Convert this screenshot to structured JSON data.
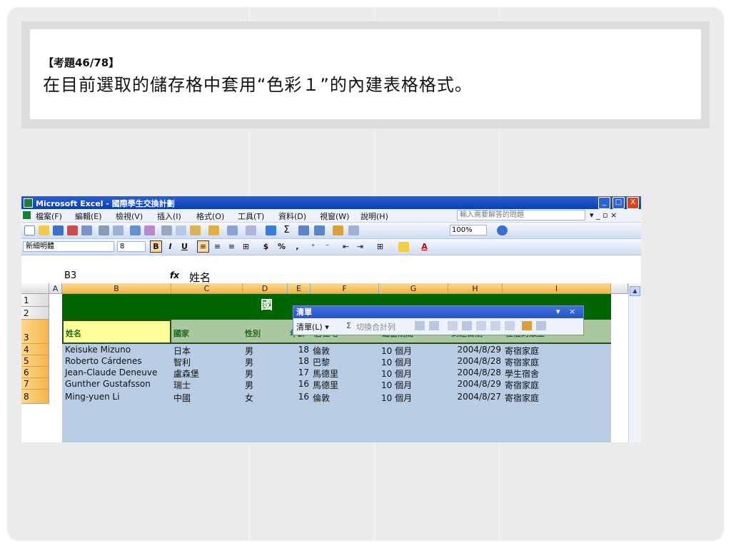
{
  "question": {
    "number": "【考題46/78】",
    "text": "在目前選取的儲存格中套用“色彩１”的內建表格格式。"
  },
  "window": {
    "title": "Microsoft Excel - 國際學生交換計劃",
    "minimize": "_",
    "restore": "□",
    "close": "X"
  },
  "menu": {
    "items": [
      "檔案(F)",
      "編輯(E)",
      "檢視(V)",
      "插入(I)",
      "格式(O)",
      "工具(T)",
      "資料(D)",
      "視窗(W)",
      "說明(H)"
    ],
    "ask_placeholder": "輸入需要解答的問題",
    "doc_controls": "▾  _  ▫  ×"
  },
  "toolbar": {
    "zoom": "100%",
    "font_name": "新細明體",
    "font_size": "8",
    "bold": "B",
    "italic": "I",
    "underline": "U",
    "currency": "$",
    "percent": "%",
    "comma": ","
  },
  "formula_bar": {
    "name_box": "B3",
    "fx": "fx",
    "content": "姓名"
  },
  "columns": [
    "A",
    "B",
    "C",
    "D",
    "E",
    "F",
    "G",
    "H",
    "I"
  ],
  "rows": [
    "1",
    "2",
    "3",
    "4",
    "5",
    "6",
    "7",
    "8"
  ],
  "title_cell": "國",
  "header": [
    "姓名",
    "國家",
    "性別",
    "年齡",
    "居住地",
    "逗留期間",
    "到達日期",
    "住宿的類型"
  ],
  "data": [
    [
      "Keisuke Mizuno",
      "日本",
      "男",
      "18",
      "倫敦",
      "10 個月",
      "2004/8/29",
      "寄宿家庭"
    ],
    [
      "Roberto Cárdenes",
      "智利",
      "男",
      "18",
      "巴黎",
      "10 個月",
      "2004/8/28",
      "寄宿家庭"
    ],
    [
      "Jean-Claude Deneuve",
      "盧森堡",
      "男",
      "17",
      "馬德里",
      "10 個月",
      "2004/8/28",
      "學生宿舍"
    ],
    [
      "Gunther Gustafsson",
      "瑞士",
      "男",
      "16",
      "馬德里",
      "10 個月",
      "2004/8/29",
      "寄宿家庭"
    ],
    [
      "Ming-yuen Li",
      "中國",
      "女",
      "16",
      "倫敦",
      "10 個月",
      "2004/8/27",
      "寄宿家庭"
    ]
  ],
  "list_panel": {
    "title": "清單",
    "menu": "清單(L) ▾",
    "toggle_total": "Σ",
    "convert": "切換合計列",
    "close": "×",
    "dropdown": "▾"
  },
  "colors": {
    "title_fill": "#006600",
    "header_fill": "#a9c8a0",
    "data_fill": "#b8cce4",
    "name_header_fill": "#ffff99",
    "selected_header": "#f3b34a"
  }
}
